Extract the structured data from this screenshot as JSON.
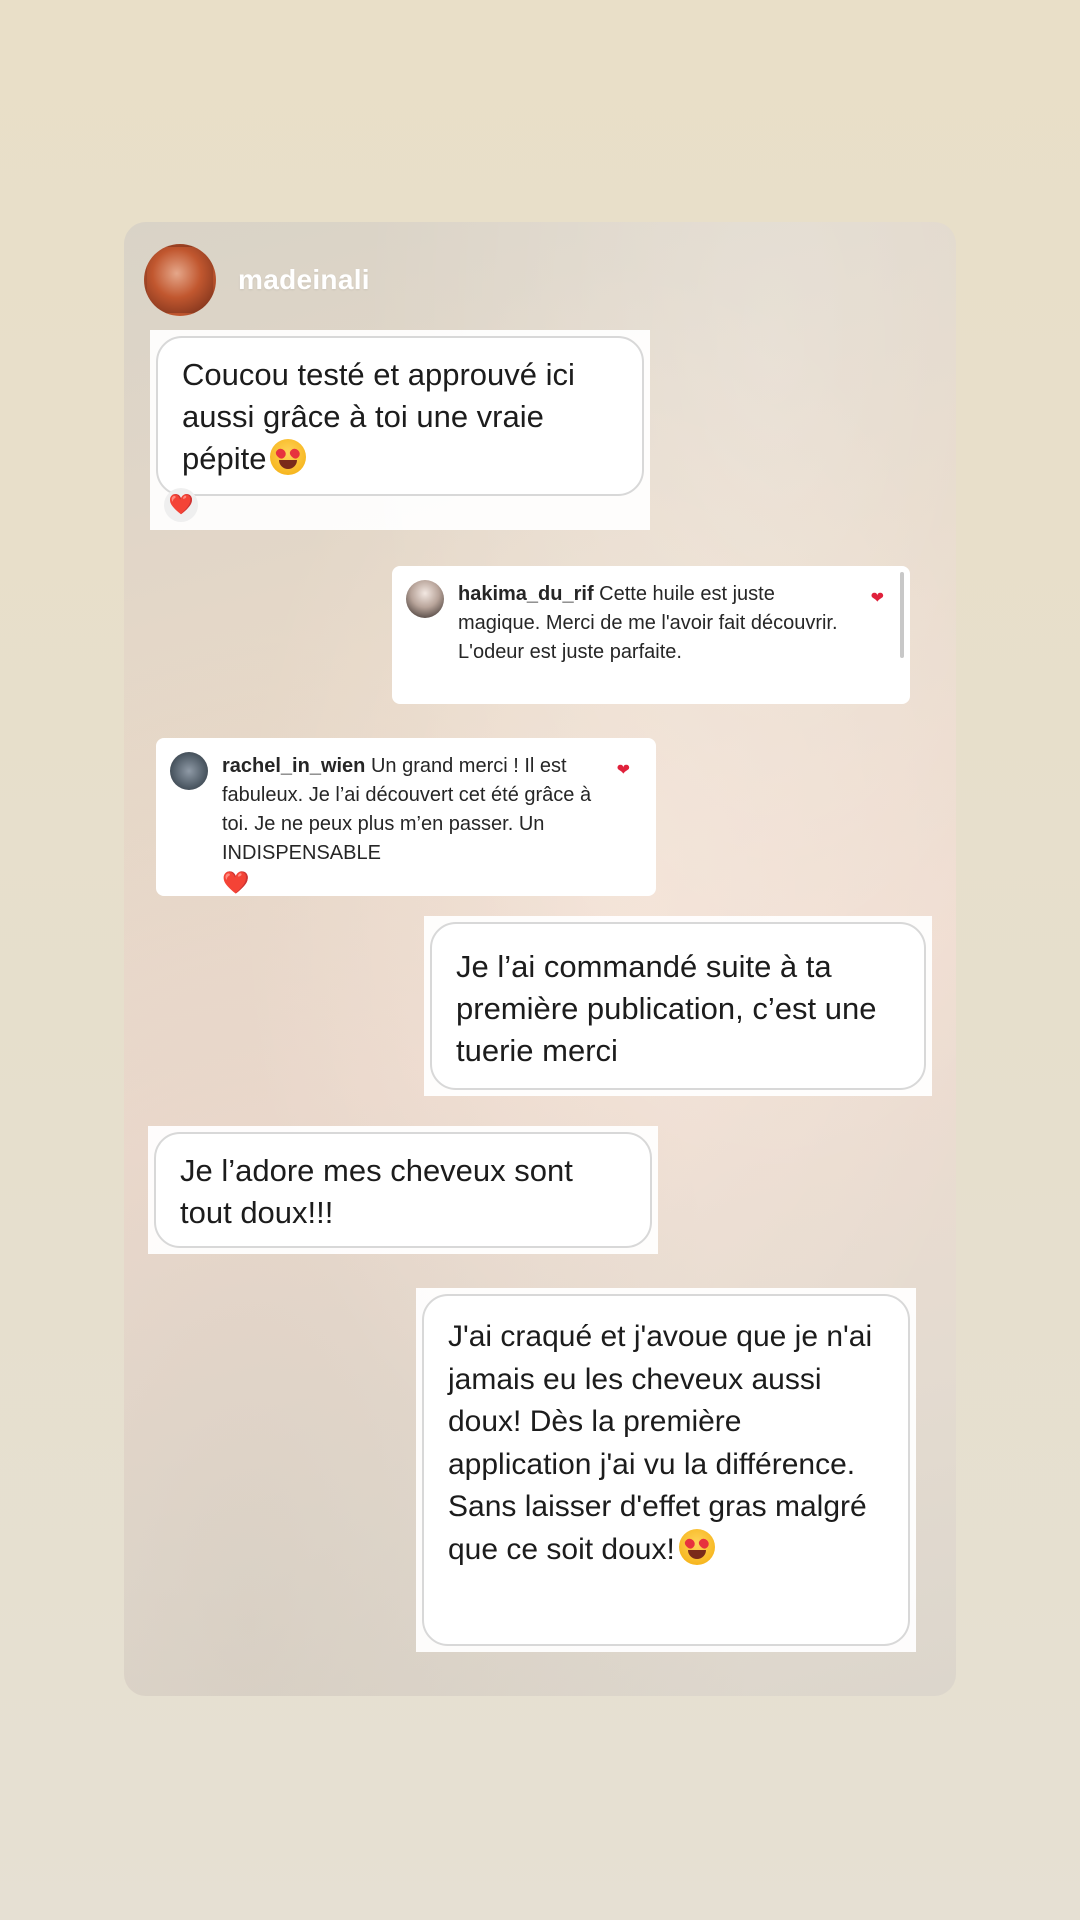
{
  "story": {
    "username": "madeinali",
    "messages": [
      {
        "text": "Coucou testé et approuvé ici aussi grâce à toi  une vraie pépite",
        "emoji": "heart-eyes-emoji",
        "reaction": "❤️"
      },
      {
        "text": "Je l’ai commandé suite à ta première publication, c’est une tuerie merci"
      },
      {
        "text": "Je l’adore mes cheveux sont tout doux!!!"
      },
      {
        "text": "J'ai craqué et j'avoue que je n'ai jamais eu les cheveux aussi doux! Dès la première application j'ai vu la différence. Sans laisser d'effet gras malgré que ce soit doux!",
        "emoji": "heart-eyes-emoji"
      }
    ],
    "comments": [
      {
        "user": "hakima_du_rif",
        "text": "Cette huile est juste magique. Merci de me l'avoir fait découvrir.  L'odeur est juste parfaite.",
        "like_icon": "❤"
      },
      {
        "user": "rachel_in_wien",
        "text": "Un grand merci ! Il est fabuleux. Je l’ai découvert cet été grâce à toi. Je ne peux plus m’en passer. Un INDISPENSABLE",
        "trailing_emoji": "❤️",
        "like_icon": "❤"
      }
    ]
  },
  "colors": {
    "background": "#e9dfc8",
    "heart": "#e0213b",
    "bubble_border": "#d8d8d8"
  }
}
